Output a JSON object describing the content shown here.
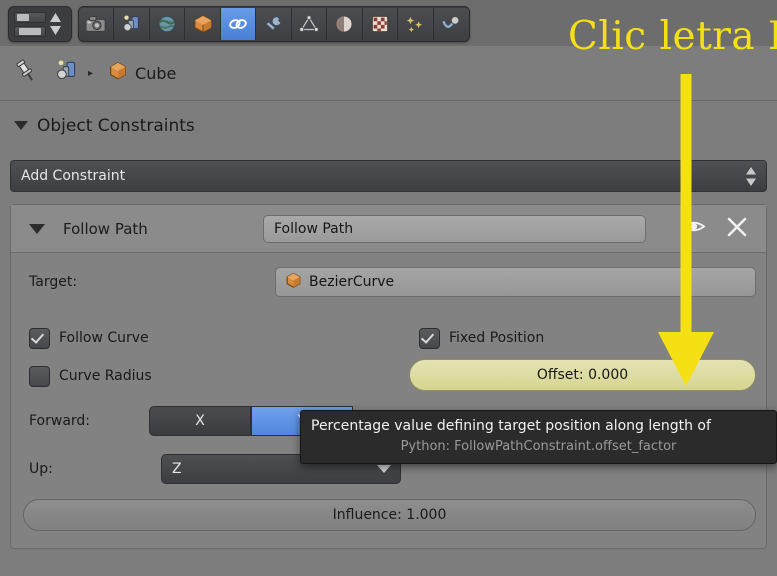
{
  "toolbar": {
    "nav": {
      "name": "properties-nav-widget",
      "bar_top": "history-back-forward",
      "bar_bottom": "pin-toggle"
    },
    "tabs": [
      {
        "id": "render",
        "icon": "camera-icon",
        "label": "Render",
        "active": false
      },
      {
        "id": "scene",
        "icon": "scene-icon",
        "label": "Scene",
        "active": false
      },
      {
        "id": "world",
        "icon": "world-globe-icon",
        "label": "World",
        "active": false
      },
      {
        "id": "object",
        "icon": "object-cube-icon",
        "label": "Object",
        "active": false
      },
      {
        "id": "constraints",
        "icon": "chain-link-icon",
        "label": "Object Constraints",
        "active": true
      },
      {
        "id": "modifiers",
        "icon": "wrench-icon",
        "label": "Modifiers",
        "active": false
      },
      {
        "id": "data",
        "icon": "mesh-data-icon",
        "label": "Object Data",
        "active": false
      },
      {
        "id": "material",
        "icon": "material-sphere-icon",
        "label": "Material",
        "active": false
      },
      {
        "id": "texture",
        "icon": "texture-checker-icon",
        "label": "Texture",
        "active": false
      },
      {
        "id": "particles",
        "icon": "particles-icon",
        "label": "Particles",
        "active": false
      },
      {
        "id": "physics",
        "icon": "physics-icon",
        "label": "Physics",
        "active": false
      }
    ]
  },
  "breadcrumb": {
    "pin_icon": "pin-icon",
    "object_icon": "scene-object-icon",
    "separator": "▸",
    "item_icon": "object-cube-icon",
    "item_label": "Cube"
  },
  "panel": {
    "expand_icon": "triangle-down-icon",
    "title": "Object Constraints"
  },
  "add_constraint": {
    "label": "Add Constraint",
    "arrows_icon": "up-down-arrows-icon"
  },
  "constraint": {
    "expand_icon": "triangle-down-icon",
    "type_label": "Follow Path",
    "name_value": "Follow Path",
    "visibility_icon": "eye-icon",
    "delete_icon": "close-x-icon",
    "target": {
      "label": "Target:",
      "icon": "object-cube-icon",
      "value": "BezierCurve"
    },
    "follow_curve": {
      "label": "Follow Curve",
      "checked": true
    },
    "curve_radius": {
      "label": "Curve Radius",
      "checked": false
    },
    "fixed_position": {
      "label": "Fixed Position",
      "checked": true
    },
    "offset": {
      "label": "Offset: 0.000",
      "value": 0.0,
      "highlighted": true
    },
    "forward": {
      "label": "Forward:",
      "options": [
        "X",
        "Y"
      ],
      "selected": "Y"
    },
    "up": {
      "label": "Up:",
      "value": "Z",
      "dropdown_icon": "triangle-down-icon"
    },
    "influence": {
      "label": "Influence: 1.000",
      "value": 1.0
    }
  },
  "tooltip": {
    "description": "Percentage value defining target position along length of",
    "python": "Python: FollowPathConstraint.offset_factor"
  },
  "annotation": {
    "text": "Clic letra I",
    "arrow_icon": "down-arrow-annotation",
    "color": "#f5e014"
  }
}
